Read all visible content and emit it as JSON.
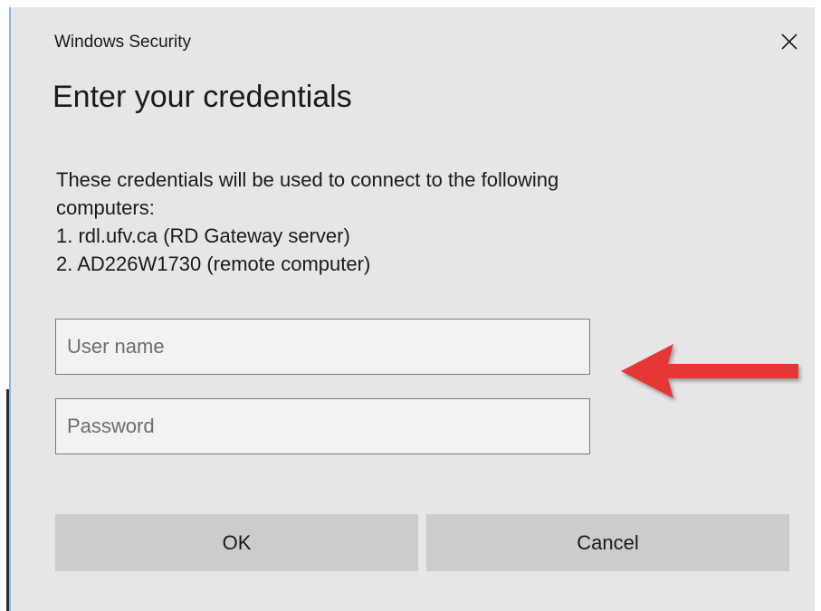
{
  "window": {
    "title": "Windows Security",
    "close_icon": "close-icon"
  },
  "dialog": {
    "heading": "Enter your credentials",
    "description_lines": [
      "These credentials will be used to connect to the following",
      "computers:",
      "1. rdl.ufv.ca (RD Gateway server)",
      "2. AD226W1730 (remote computer)"
    ]
  },
  "form": {
    "username": {
      "value": "",
      "placeholder": "User name"
    },
    "password": {
      "value": "",
      "placeholder": "Password"
    }
  },
  "buttons": {
    "ok_label": "OK",
    "cancel_label": "Cancel"
  },
  "annotation": {
    "arrow_icon": "left-arrow-icon",
    "arrow_color": "#e53935"
  },
  "colors": {
    "dialog_background": "#e6e6e6",
    "button_background": "#cccccc",
    "field_border": "#7a7a7a"
  }
}
